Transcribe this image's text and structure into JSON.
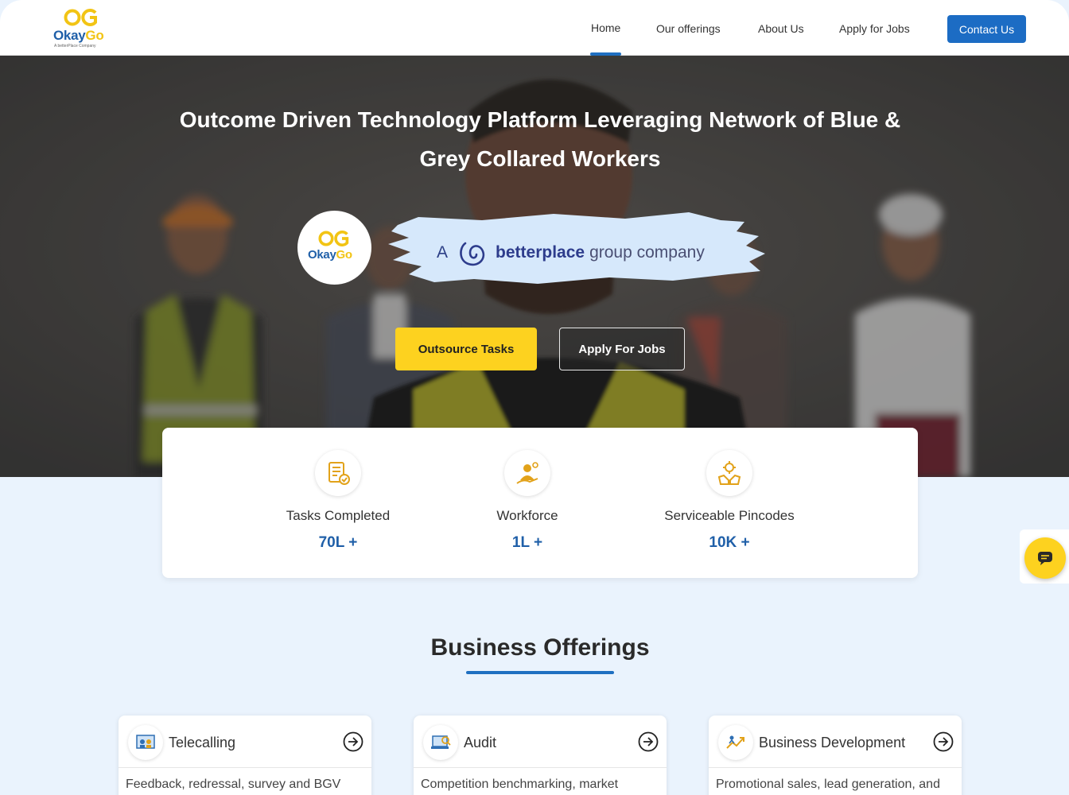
{
  "brand": {
    "logo_og": "OG",
    "logo_okay": "Okay",
    "logo_go": "Go",
    "logo_tagline": "A betterPlace Company",
    "primary_color": "#1c6cc4",
    "accent_color": "#fdd21f"
  },
  "nav": {
    "items": [
      {
        "label": "Home",
        "active": true
      },
      {
        "label": "Our offerings"
      },
      {
        "label": "About Us"
      },
      {
        "label": "Apply for Jobs"
      }
    ],
    "contact_label": "Contact Us"
  },
  "hero": {
    "title": "Outcome Driven Technology Platform Leveraging Network of Blue & Grey Collared Workers",
    "group_prefix": "A",
    "group_brand": "betterplace",
    "group_suffix": "group company",
    "primary_cta": "Outsource Tasks",
    "secondary_cta": "Apply For Jobs"
  },
  "stats": [
    {
      "label": "Tasks Completed",
      "value": "70L +",
      "icon": "tasks-checklist-icon"
    },
    {
      "label": "Workforce",
      "value": "1L +",
      "icon": "workforce-icon"
    },
    {
      "label": "Serviceable Pincodes",
      "value": "10K +",
      "icon": "pincode-hands-icon"
    }
  ],
  "offerings": {
    "title": "Business Offerings",
    "cards": [
      {
        "title": "Telecalling",
        "desc": "Feedback, redressal, survey and BGV",
        "icon": "telecalling-icon"
      },
      {
        "title": "Audit",
        "desc": "Competition benchmarking, market",
        "icon": "audit-icon"
      },
      {
        "title": "Business Development",
        "desc": "Promotional sales, lead generation, and",
        "icon": "business-development-icon"
      }
    ]
  },
  "chat": {
    "icon": "chat-icon"
  }
}
